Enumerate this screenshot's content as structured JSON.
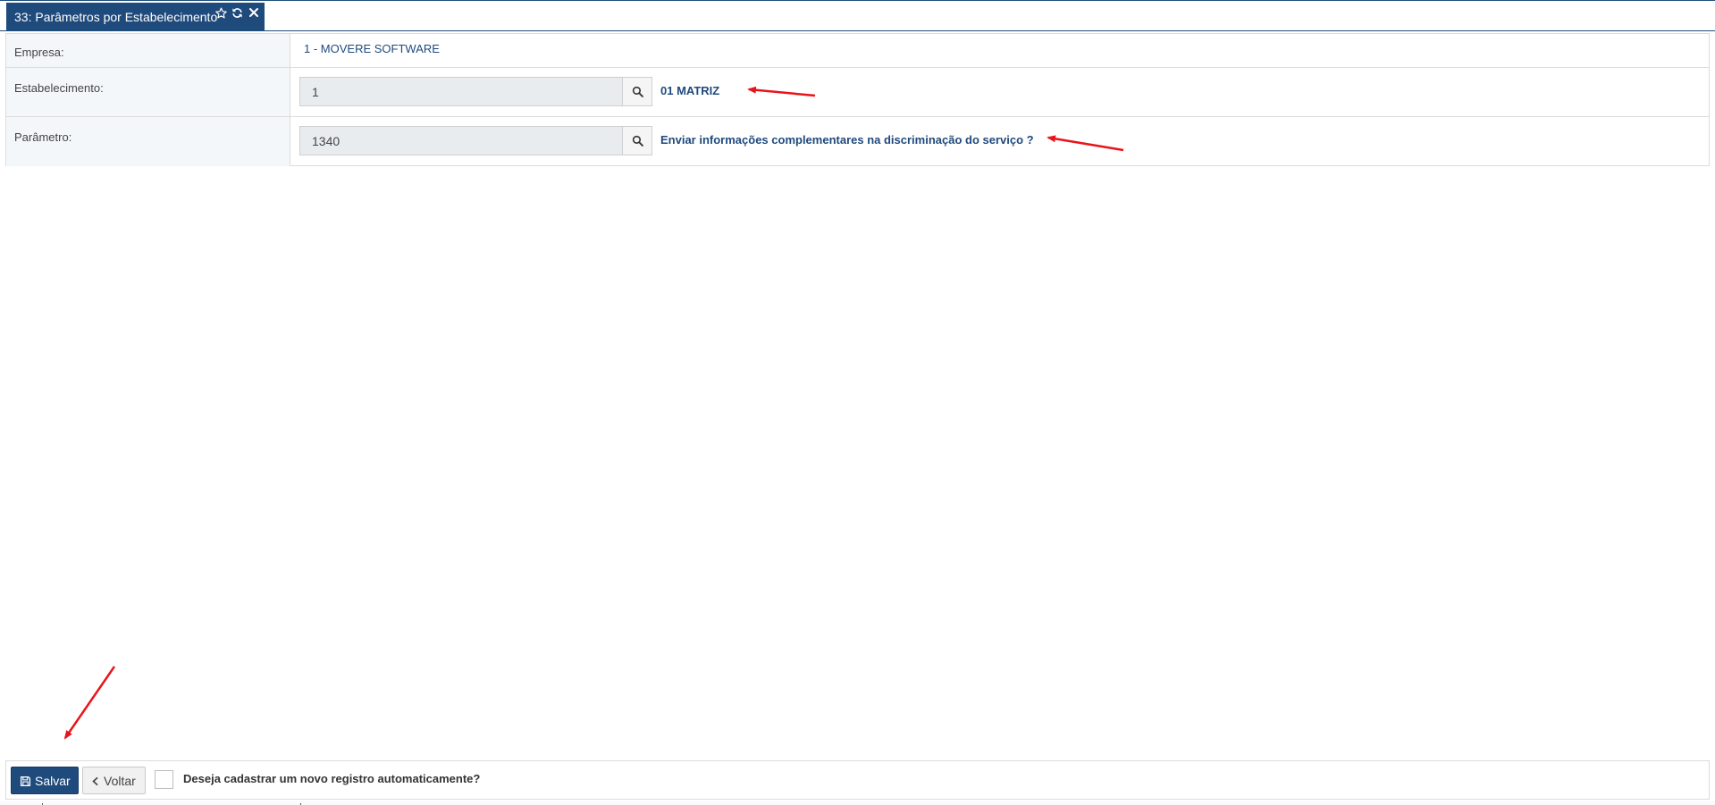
{
  "tab": {
    "title": "33: Parâmetros por Estabelecimento",
    "icons": [
      "star-outline-icon",
      "refresh-icon",
      "close-icon"
    ]
  },
  "form": {
    "empresa": {
      "label": "Empresa:",
      "value": "1 - MOVERE SOFTWARE"
    },
    "estabelecimento": {
      "label": "Estabelecimento:",
      "input_value": "1",
      "description": "01 MATRIZ",
      "button_icon": "search-icon"
    },
    "parametro": {
      "label": "Parâmetro:",
      "input_value": "1340",
      "description": "Enviar informações complementares na discriminação do serviço ?",
      "button_icon": "search-icon"
    }
  },
  "footer": {
    "save_label": "Salvar",
    "back_label": "Voltar",
    "auto_new_label": "Deseja cadastrar um novo registro automaticamente?",
    "auto_new_checked": false
  },
  "colors": {
    "primary": "#1f4a7c",
    "label_bg": "#f4f7fa",
    "input_bg": "#e9ecef",
    "annotation_arrow": "#e8141b"
  }
}
